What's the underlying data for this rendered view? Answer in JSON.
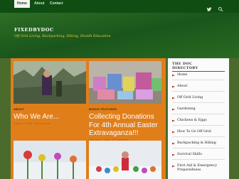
{
  "nav": {
    "items": [
      {
        "label": "Home",
        "active": true
      },
      {
        "label": "About",
        "active": false
      },
      {
        "label": "Contact",
        "active": false
      }
    ],
    "icons": [
      "twitter-icon",
      "search-icon"
    ]
  },
  "header": {
    "title": "FIXEDBYDOC",
    "tagline": "Off Grid Living, Backpacking, Hiking, Health Education"
  },
  "posts": [
    {
      "category": "ABOUT",
      "title": "Who We Are...",
      "meta": "August 10, 2016 · No Comments"
    },
    {
      "category": "BONUS FEATURES",
      "title": "Collecting Donations For 4th Annual Easter Extravaganza!!!",
      "meta": "February 17, 2018 · No Comments"
    }
  ],
  "sidebar": {
    "heading_line1": "THE DOC",
    "heading_line2": "DIRECTORY",
    "items": [
      "Home",
      "About",
      "Off Grid Living",
      "Gardening",
      "Chickens & Eggs",
      "How To Go Off Grid",
      "Backpacking & Hiking",
      "Survival Skills",
      "First Aid & Emergency Preparedness"
    ]
  },
  "colors": {
    "nav_bg": "#0f4d12",
    "header_bg": "#1e5a1e",
    "content_bg": "#e07e1a",
    "tagline": "#f0c73c",
    "bullet": "#c0392b"
  }
}
